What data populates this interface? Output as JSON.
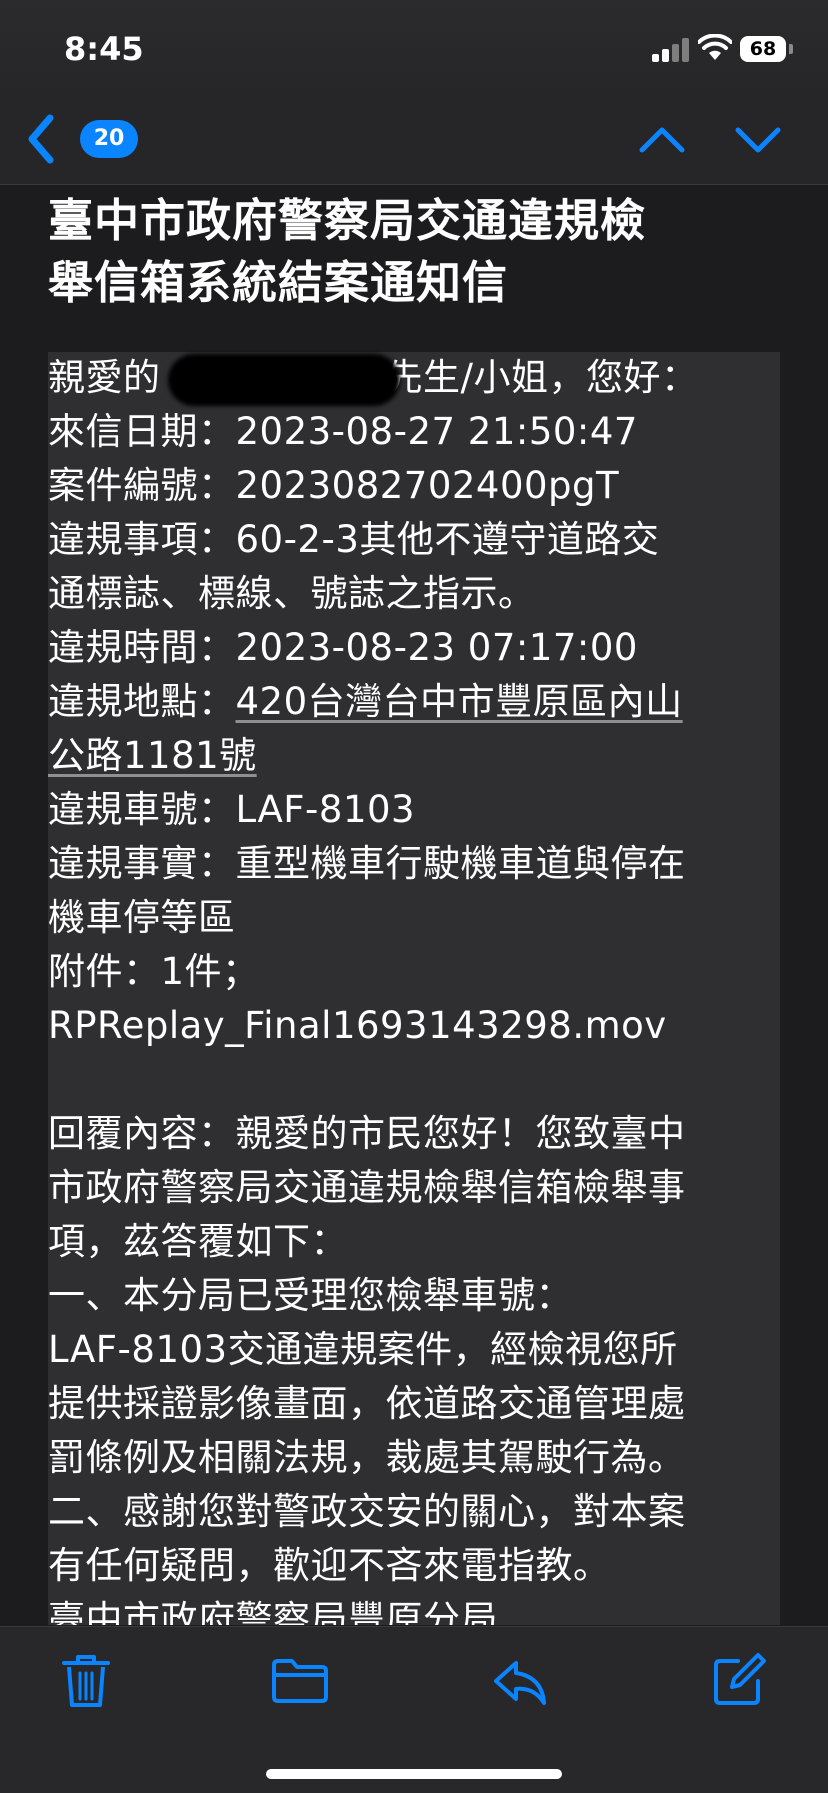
{
  "status": {
    "time": "8:45",
    "battery": "68"
  },
  "nav": {
    "unread_count": "20"
  },
  "email": {
    "subject_lines": [
      "臺中市政府警察局交通違規檢",
      "舉信箱系統結案通知信"
    ],
    "body_lines": [
      "親愛的　　　　　　先生/小姐，您好：",
      "來信日期：2023-08-27 21:50:47",
      "案件編號：2023082702400pgT",
      "違規事項：60-2-3其他不遵守道路交",
      "通標誌、標線、號誌之指示。",
      "違規時間：2023-08-23 07:17:00",
      "違規地點：",
      "公路1181號",
      "違規車號：LAF-8103",
      "違規事實：重型機車行駛機車道與停在",
      "機車停等區",
      "附件：1件；",
      "RPReplay_Final1693143298.mov",
      "",
      "回覆內容：親愛的市民您好！您致臺中",
      "市政府警察局交通違規檢舉信箱檢舉事",
      "項，茲答覆如下：",
      "一、本分局已受理您檢舉車號：",
      "LAF-8103交通違規案件，經檢視您所",
      "提供採證影像畫面，依道路交通管理處",
      "罰條例及相關法規，裁處其駕駛行為。",
      "二、感謝您對警政交安的關心，對本案",
      "有任何疑問，歡迎不吝來電指教。",
      "臺中市政府警察局豐原分局"
    ],
    "address_link": "420台灣台中市豐原區內山"
  },
  "colors": {
    "accent": "#0a84ff",
    "background": "#1c1c1e",
    "body_block": "#2f2f31",
    "toolbar": "#28282a"
  },
  "icons": [
    "back-chevron-icon",
    "up-chevron-icon",
    "down-chevron-icon",
    "trash-icon",
    "folder-icon",
    "reply-icon",
    "compose-icon"
  ]
}
